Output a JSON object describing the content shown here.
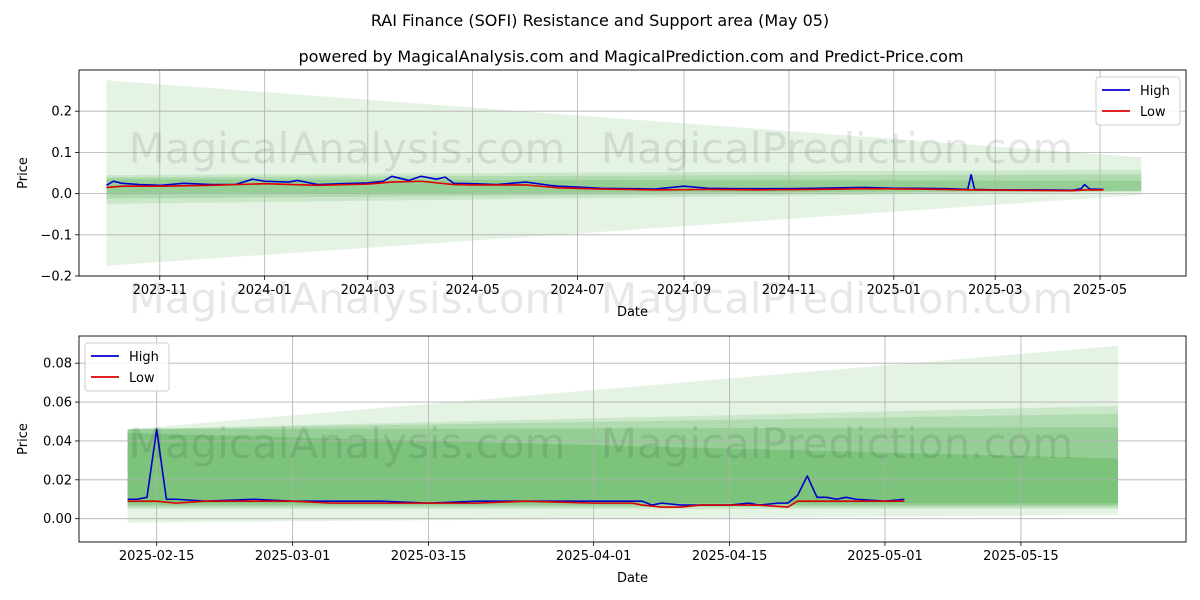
{
  "title": "RAI Finance (SOFI) Resistance and Support area (May 05)",
  "subtitle": "powered by MagicalAnalysis.com and MagicalPrediction.com and Predict-Price.com",
  "watermarks": [
    "MagicalAnalysis.com",
    "MagicalPrediction.com"
  ],
  "colors": {
    "high": "#0000cc",
    "low": "#dd0000",
    "band": "#2ca02c",
    "grid": "#b0b0b0"
  },
  "chart_data": [
    {
      "type": "line",
      "xlabel": "Date",
      "ylabel": "Price",
      "ylim": [
        -0.2,
        0.3
      ],
      "yticks": [
        -0.2,
        -0.1,
        0.0,
        0.1,
        0.2
      ],
      "ytick_labels": [
        "−0.2",
        "−0.1",
        "0.0",
        "0.1",
        "0.2"
      ],
      "xlim": [
        "2023-09-15",
        "2025-06-20"
      ],
      "xticks": [
        "2023-11-01",
        "2024-01-01",
        "2024-03-01",
        "2024-05-01",
        "2024-07-01",
        "2024-09-01",
        "2024-11-01",
        "2025-01-01",
        "2025-03-01",
        "2025-05-01"
      ],
      "xtick_labels": [
        "2023-11",
        "2024-01",
        "2024-03",
        "2024-05",
        "2024-07",
        "2024-09",
        "2024-11",
        "2025-01",
        "2025-03",
        "2025-05"
      ],
      "grid": true,
      "legend": "top-right",
      "bands": [
        {
          "x": [
            "2023-10-01",
            "2025-05-25"
          ],
          "upper": [
            0.275,
            0.088
          ],
          "lower": [
            -0.175,
            -0.003
          ]
        },
        {
          "x": [
            "2023-10-01",
            "2025-05-25"
          ],
          "upper": [
            0.045,
            0.058
          ],
          "lower": [
            -0.025,
            0.005
          ]
        },
        {
          "x": [
            "2023-10-01",
            "2025-05-25"
          ],
          "upper": [
            0.04,
            0.047
          ],
          "lower": [
            -0.012,
            0.006
          ]
        },
        {
          "x": [
            "2023-10-01",
            "2025-05-25"
          ],
          "upper": [
            0.035,
            0.031
          ],
          "lower": [
            -0.002,
            0.007
          ]
        }
      ],
      "series": [
        {
          "name": "High",
          "color": "#0000cc",
          "x": [
            "2023-10-01",
            "2023-10-05",
            "2023-10-10",
            "2023-10-20",
            "2023-11-01",
            "2023-11-15",
            "2023-12-01",
            "2023-12-15",
            "2023-12-25",
            "2024-01-01",
            "2024-01-15",
            "2024-01-20",
            "2024-02-01",
            "2024-02-15",
            "2024-03-01",
            "2024-03-10",
            "2024-03-15",
            "2024-03-25",
            "2024-04-01",
            "2024-04-10",
            "2024-04-15",
            "2024-04-20",
            "2024-05-01",
            "2024-05-15",
            "2024-06-01",
            "2024-06-15",
            "2024-06-20",
            "2024-07-01",
            "2024-07-15",
            "2024-08-01",
            "2024-08-15",
            "2024-09-01",
            "2024-09-15",
            "2024-10-01",
            "2024-10-15",
            "2024-11-01",
            "2024-11-15",
            "2024-12-01",
            "2024-12-15",
            "2025-01-01",
            "2025-01-15",
            "2025-02-01",
            "2025-02-13",
            "2025-02-15",
            "2025-02-17",
            "2025-03-01",
            "2025-03-15",
            "2025-04-01",
            "2025-04-15",
            "2025-04-20",
            "2025-04-22",
            "2025-04-25",
            "2025-05-03"
          ],
          "values": [
            0.02,
            0.03,
            0.025,
            0.022,
            0.02,
            0.025,
            0.022,
            0.022,
            0.035,
            0.03,
            0.028,
            0.032,
            0.022,
            0.024,
            0.026,
            0.03,
            0.042,
            0.032,
            0.042,
            0.035,
            0.04,
            0.025,
            0.024,
            0.022,
            0.028,
            0.02,
            0.018,
            0.016,
            0.013,
            0.012,
            0.011,
            0.018,
            0.013,
            0.012,
            0.012,
            0.012,
            0.013,
            0.014,
            0.015,
            0.013,
            0.013,
            0.012,
            0.01,
            0.046,
            0.01,
            0.009,
            0.009,
            0.009,
            0.008,
            0.012,
            0.022,
            0.011,
            0.01
          ]
        },
        {
          "name": "Low",
          "color": "#dd0000",
          "x": [
            "2023-10-01",
            "2023-10-10",
            "2023-11-01",
            "2023-12-01",
            "2024-01-01",
            "2024-02-01",
            "2024-03-01",
            "2024-03-15",
            "2024-04-01",
            "2024-04-20",
            "2024-05-01",
            "2024-06-01",
            "2024-06-20",
            "2024-07-15",
            "2024-08-15",
            "2024-09-15",
            "2024-10-15",
            "2024-11-15",
            "2024-12-15",
            "2025-01-15",
            "2025-02-15",
            "2025-03-15",
            "2025-04-15",
            "2025-04-22",
            "2025-05-03"
          ],
          "values": [
            0.015,
            0.018,
            0.018,
            0.02,
            0.024,
            0.02,
            0.023,
            0.028,
            0.03,
            0.022,
            0.021,
            0.021,
            0.014,
            0.011,
            0.009,
            0.01,
            0.009,
            0.01,
            0.012,
            0.011,
            0.009,
            0.008,
            0.007,
            0.009,
            0.009
          ]
        }
      ]
    },
    {
      "type": "line",
      "xlabel": "Date",
      "ylabel": "Price",
      "ylim": [
        -0.012,
        0.094
      ],
      "yticks": [
        0.0,
        0.02,
        0.04,
        0.06,
        0.08
      ],
      "ytick_labels": [
        "0.00",
        "0.02",
        "0.04",
        "0.06",
        "0.08"
      ],
      "xlim": [
        "2025-02-07",
        "2025-06-01"
      ],
      "xticks": [
        "2025-02-15",
        "2025-03-01",
        "2025-03-15",
        "2025-04-01",
        "2025-04-15",
        "2025-05-01",
        "2025-05-15"
      ],
      "xtick_labels": [
        "2025-02-15",
        "2025-03-01",
        "2025-03-15",
        "2025-04-01",
        "2025-04-15",
        "2025-05-01",
        "2025-05-15"
      ],
      "grid": true,
      "legend": "top-left",
      "bands": [
        {
          "x": [
            "2025-02-12",
            "2025-05-25"
          ],
          "upper": [
            0.046,
            0.089
          ],
          "lower": [
            -0.002,
            0.002
          ]
        },
        {
          "x": [
            "2025-02-12",
            "2025-05-25"
          ],
          "upper": [
            0.046,
            0.058
          ],
          "lower": [
            0.005,
            0.005
          ]
        },
        {
          "x": [
            "2025-02-12",
            "2025-05-25"
          ],
          "upper": [
            0.046,
            0.054
          ],
          "lower": [
            0.006,
            0.006
          ]
        },
        {
          "x": [
            "2025-02-12",
            "2025-05-25"
          ],
          "upper": [
            0.046,
            0.047
          ],
          "lower": [
            0.007,
            0.007
          ]
        },
        {
          "x": [
            "2025-02-12",
            "2025-05-25"
          ],
          "upper": [
            0.044,
            0.031
          ],
          "lower": [
            0.008,
            0.008
          ]
        }
      ],
      "series": [
        {
          "name": "High",
          "color": "#0000cc",
          "x": [
            "2025-02-12",
            "2025-02-13",
            "2025-02-14",
            "2025-02-15",
            "2025-02-16",
            "2025-02-17",
            "2025-02-20",
            "2025-02-25",
            "2025-03-01",
            "2025-03-05",
            "2025-03-10",
            "2025-03-15",
            "2025-03-20",
            "2025-03-25",
            "2025-04-01",
            "2025-04-05",
            "2025-04-06",
            "2025-04-07",
            "2025-04-08",
            "2025-04-10",
            "2025-04-12",
            "2025-04-15",
            "2025-04-17",
            "2025-04-18",
            "2025-04-20",
            "2025-04-21",
            "2025-04-22",
            "2025-04-23",
            "2025-04-24",
            "2025-04-25",
            "2025-04-26",
            "2025-04-27",
            "2025-04-28",
            "2025-05-01",
            "2025-05-03"
          ],
          "values": [
            0.01,
            0.01,
            0.011,
            0.046,
            0.01,
            0.01,
            0.009,
            0.01,
            0.009,
            0.009,
            0.009,
            0.008,
            0.009,
            0.009,
            0.009,
            0.009,
            0.009,
            0.007,
            0.008,
            0.007,
            0.007,
            0.007,
            0.008,
            0.007,
            0.008,
            0.008,
            0.012,
            0.022,
            0.011,
            0.011,
            0.01,
            0.011,
            0.01,
            0.009,
            0.01
          ]
        },
        {
          "name": "Low",
          "color": "#dd0000",
          "x": [
            "2025-02-12",
            "2025-02-15",
            "2025-02-17",
            "2025-02-20",
            "2025-02-25",
            "2025-03-01",
            "2025-03-05",
            "2025-03-10",
            "2025-03-15",
            "2025-03-20",
            "2025-03-25",
            "2025-04-01",
            "2025-04-05",
            "2025-04-06",
            "2025-04-08",
            "2025-04-10",
            "2025-04-12",
            "2025-04-15",
            "2025-04-18",
            "2025-04-21",
            "2025-04-22",
            "2025-04-25",
            "2025-05-01",
            "2025-05-03"
          ],
          "values": [
            0.009,
            0.009,
            0.008,
            0.009,
            0.009,
            0.009,
            0.008,
            0.008,
            0.008,
            0.008,
            0.009,
            0.008,
            0.008,
            0.007,
            0.006,
            0.006,
            0.007,
            0.007,
            0.007,
            0.006,
            0.009,
            0.009,
            0.009,
            0.009
          ]
        }
      ]
    }
  ]
}
